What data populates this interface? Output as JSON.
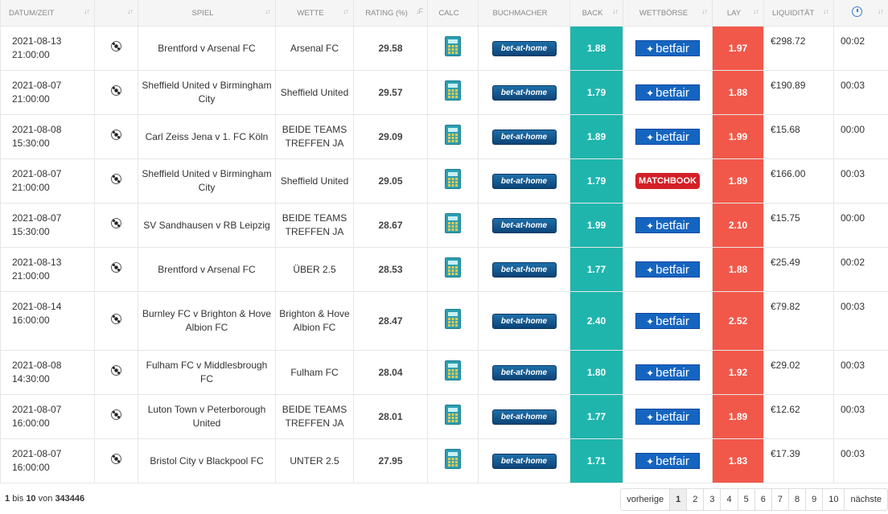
{
  "headers": {
    "datetime": "DATUM/ZEIT",
    "sport": "",
    "match": "SPIEL",
    "bet": "WETTE",
    "rating": "RATING (%)",
    "calc": "CALC",
    "bookmaker": "BUCHMACHER",
    "back": "BACK",
    "exchange": "WETTBÖRSE",
    "lay": "LAY",
    "liquidity": "LIQUIDITÄT"
  },
  "rows": [
    {
      "date": "2021-08-13",
      "time": "21:00:00",
      "match": "Brentford v Arsenal FC",
      "bet": "Arsenal FC",
      "rating": "29.58",
      "bookmaker": "bet-at-home",
      "back": "1.88",
      "exchange": "betfair",
      "lay": "1.97",
      "liquidity": "€298.72",
      "age": "00:02"
    },
    {
      "date": "2021-08-07",
      "time": "21:00:00",
      "match": "Sheffield United v Birmingham City",
      "bet": "Sheffield United",
      "rating": "29.57",
      "bookmaker": "bet-at-home",
      "back": "1.79",
      "exchange": "betfair",
      "lay": "1.88",
      "liquidity": "€190.89",
      "age": "00:03"
    },
    {
      "date": "2021-08-08",
      "time": "15:30:00",
      "match": "Carl Zeiss Jena v 1. FC Köln",
      "bet": "BEIDE TEAMS TREFFEN JA",
      "rating": "29.09",
      "bookmaker": "bet-at-home",
      "back": "1.89",
      "exchange": "betfair",
      "lay": "1.99",
      "liquidity": "€15.68",
      "age": "00:00"
    },
    {
      "date": "2021-08-07",
      "time": "21:00:00",
      "match": "Sheffield United v Birmingham City",
      "bet": "Sheffield United",
      "rating": "29.05",
      "bookmaker": "bet-at-home",
      "back": "1.79",
      "exchange": "MATCHBOOK",
      "lay": "1.89",
      "liquidity": "€166.00",
      "age": "00:03"
    },
    {
      "date": "2021-08-07",
      "time": "15:30:00",
      "match": "SV Sandhausen v RB Leipzig",
      "bet": "BEIDE TEAMS TREFFEN JA",
      "rating": "28.67",
      "bookmaker": "bet-at-home",
      "back": "1.99",
      "exchange": "betfair",
      "lay": "2.10",
      "liquidity": "€15.75",
      "age": "00:00"
    },
    {
      "date": "2021-08-13",
      "time": "21:00:00",
      "match": "Brentford v Arsenal FC",
      "bet": "ÜBER 2.5",
      "rating": "28.53",
      "bookmaker": "bet-at-home",
      "back": "1.77",
      "exchange": "betfair",
      "lay": "1.88",
      "liquidity": "€25.49",
      "age": "00:02"
    },
    {
      "date": "2021-08-14",
      "time": "16:00:00",
      "match": "Burnley FC v Brighton & Hove Albion FC",
      "bet": "Brighton & Hove Albion FC",
      "rating": "28.47",
      "bookmaker": "bet-at-home",
      "back": "2.40",
      "exchange": "betfair",
      "lay": "2.52",
      "liquidity": "€79.82",
      "age": "00:03"
    },
    {
      "date": "2021-08-08",
      "time": "14:30:00",
      "match": "Fulham FC v Middlesbrough FC",
      "bet": "Fulham FC",
      "rating": "28.04",
      "bookmaker": "bet-at-home",
      "back": "1.80",
      "exchange": "betfair",
      "lay": "1.92",
      "liquidity": "€29.02",
      "age": "00:03"
    },
    {
      "date": "2021-08-07",
      "time": "16:00:00",
      "match": "Luton Town v Peterborough United",
      "bet": "BEIDE TEAMS TREFFEN JA",
      "rating": "28.01",
      "bookmaker": "bet-at-home",
      "back": "1.77",
      "exchange": "betfair",
      "lay": "1.89",
      "liquidity": "€12.62",
      "age": "00:03"
    },
    {
      "date": "2021-08-07",
      "time": "16:00:00",
      "match": "Bristol City v Blackpool FC",
      "bet": "UNTER 2.5",
      "rating": "27.95",
      "bookmaker": "bet-at-home",
      "back": "1.71",
      "exchange": "betfair",
      "lay": "1.83",
      "liquidity": "€17.39",
      "age": "00:03"
    }
  ],
  "footer": {
    "from": "1",
    "bis": "bis",
    "to": "10",
    "von": "von",
    "total": "343446"
  },
  "pagination": {
    "prev": "vorherige",
    "pages": [
      "1",
      "2",
      "3",
      "4",
      "5",
      "6",
      "7",
      "8",
      "9",
      "10"
    ],
    "active": "1",
    "next": "nächste"
  },
  "colors": {
    "back": "#1fb5ad",
    "lay": "#f1584a"
  },
  "icons": {
    "sport": "soccer-ball-icon",
    "calc": "calculator-icon",
    "age": "clock-icon"
  }
}
